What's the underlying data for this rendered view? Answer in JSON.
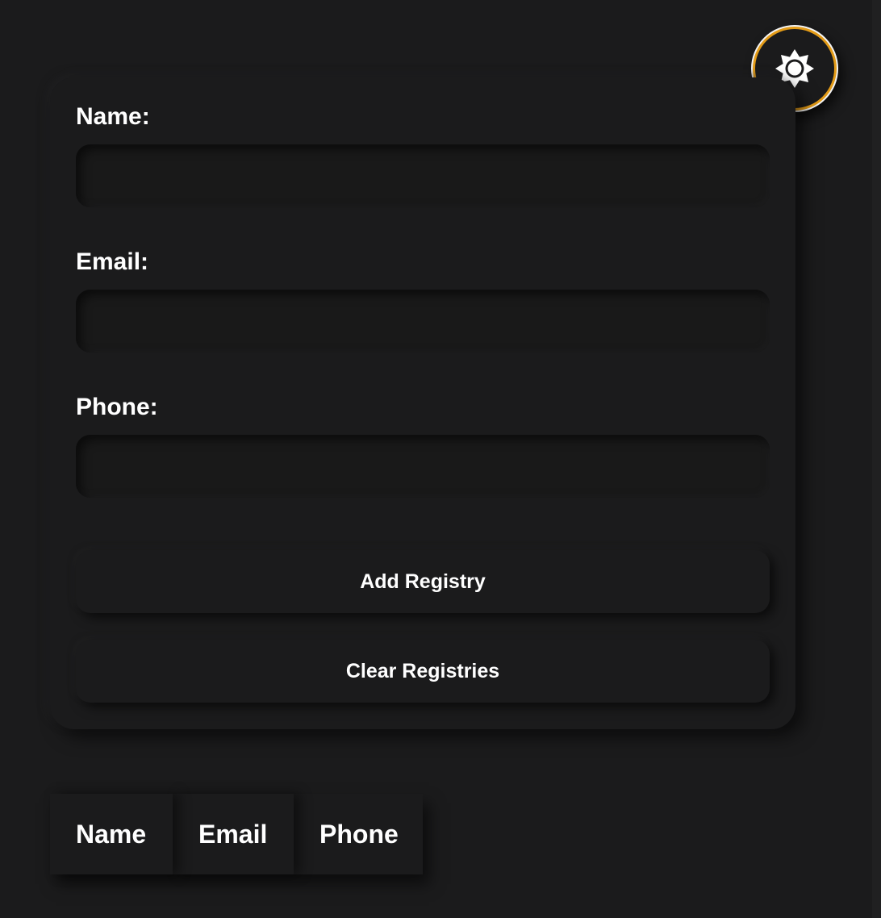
{
  "form": {
    "name_label": "Name:",
    "name_value": "",
    "email_label": "Email:",
    "email_value": "",
    "phone_label": "Phone:",
    "phone_value": "",
    "add_button": "Add Registry",
    "clear_button": "Clear Registries"
  },
  "table": {
    "columns": [
      "Name",
      "Email",
      "Phone"
    ]
  },
  "theme_toggle": {
    "icon": "sun-icon",
    "accent": "#e39b17"
  },
  "colors": {
    "background": "#1b1b1c",
    "text": "#ffffff"
  }
}
